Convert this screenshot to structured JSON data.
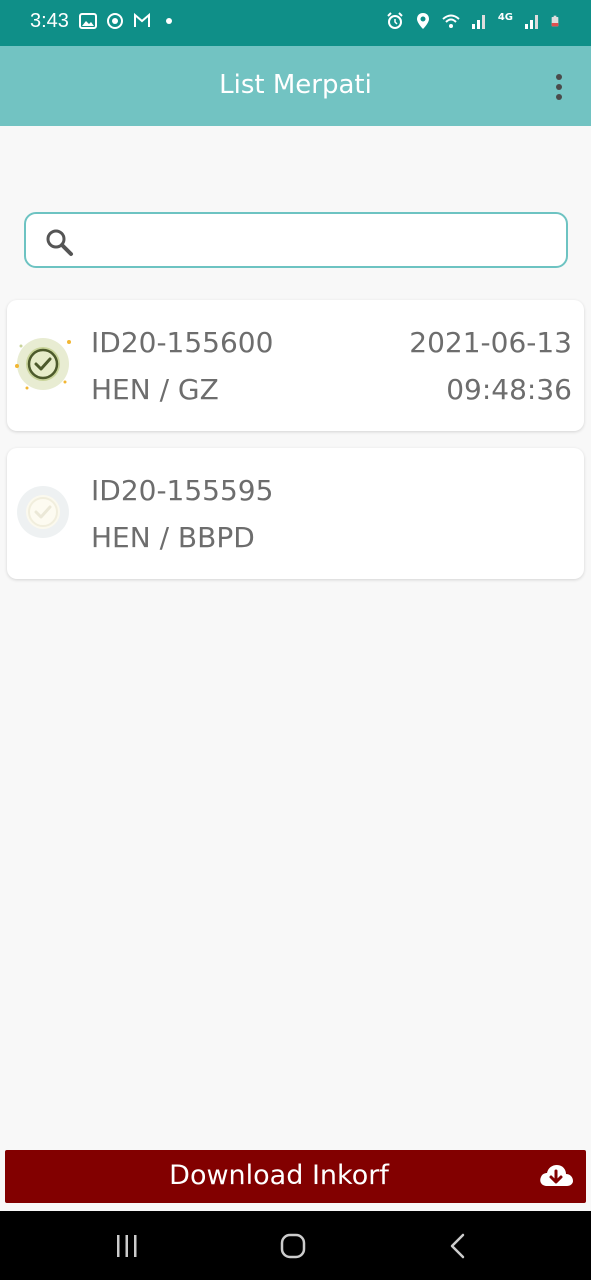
{
  "status_bar": {
    "time": "3:43",
    "left_icons": [
      "image-icon",
      "sync-icon",
      "gmail-icon",
      "dot-icon"
    ],
    "right_icons": [
      "alarm-icon",
      "location-icon",
      "wifi-icon",
      "signal-icon",
      "4g-icon",
      "signal-icon",
      "battery-icon"
    ],
    "network_label": "4G"
  },
  "app_bar": {
    "title": "List Merpati",
    "menu_icon": "more-vert-icon"
  },
  "search": {
    "placeholder": "",
    "value": "",
    "icon": "search-icon"
  },
  "items": [
    {
      "id": "ID20-155600",
      "subtitle": "HEN / GZ",
      "date": "2021-06-13",
      "time": "09:48:36",
      "status_icon": "check-badge-icon",
      "status": "checked"
    },
    {
      "id": "ID20-155595",
      "subtitle": "HEN / BBPD",
      "date": "",
      "time": "",
      "status_icon": "check-badge-faded-icon",
      "status": "unchecked"
    }
  ],
  "download_button": {
    "label": "Download Inkorf",
    "icon": "cloud-download-icon"
  },
  "colors": {
    "status_bar": "#0f8f88",
    "app_bar": "#72c3c2",
    "accent": "#6dc3c2",
    "download_button": "#820000",
    "background": "#f8f8f8",
    "text": "#6d6d6d"
  },
  "nav_bar": {
    "buttons": [
      "recents-icon",
      "home-icon",
      "back-icon"
    ]
  }
}
